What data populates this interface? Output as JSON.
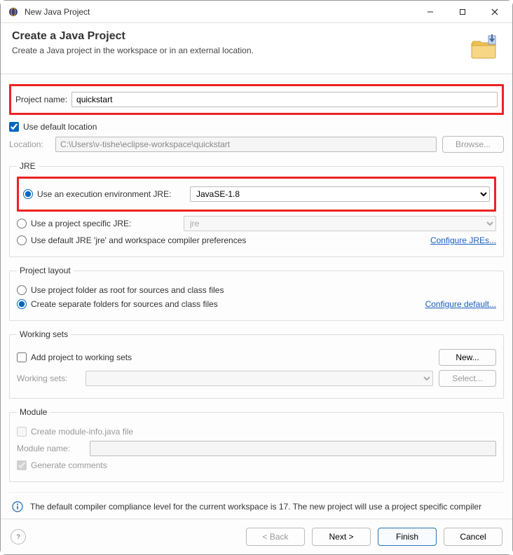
{
  "window": {
    "title": "New Java Project"
  },
  "banner": {
    "heading": "Create a Java Project",
    "subheading": "Create a Java project in the workspace or in an external location."
  },
  "project_name": {
    "label": "Project name:",
    "value": "quickstart"
  },
  "default_location": {
    "checkbox_label": "Use default location",
    "checked": true,
    "location_label": "Location:",
    "location_value": "C:\\Users\\v-tishe\\eclipse-workspace\\quickstart",
    "browse_label": "Browse..."
  },
  "jre": {
    "legend": "JRE",
    "exec_env_label": "Use an execution environment JRE:",
    "exec_env_value": "JavaSE-1.8",
    "project_jre_label": "Use a project specific JRE:",
    "project_jre_value": "jre",
    "default_jre_label": "Use default JRE 'jre' and workspace compiler preferences",
    "configure_link": "Configure JREs..."
  },
  "project_layout": {
    "legend": "Project layout",
    "root_label": "Use project folder as root for sources and class files",
    "separate_label": "Create separate folders for sources and class files",
    "configure_link": "Configure default..."
  },
  "working_sets": {
    "legend": "Working sets",
    "checkbox_label": "Add project to working sets",
    "new_button": "New...",
    "sets_label": "Working sets:",
    "select_button": "Select..."
  },
  "module": {
    "legend": "Module",
    "create_info_label": "Create module-info.java file",
    "name_label": "Module name:",
    "name_value": "",
    "gen_comments_label": "Generate comments"
  },
  "info_message": "The default compiler compliance level for the current workspace is 17. The new project will use a project specific compiler",
  "footer": {
    "back": "< Back",
    "next": "Next >",
    "finish": "Finish",
    "cancel": "Cancel"
  }
}
